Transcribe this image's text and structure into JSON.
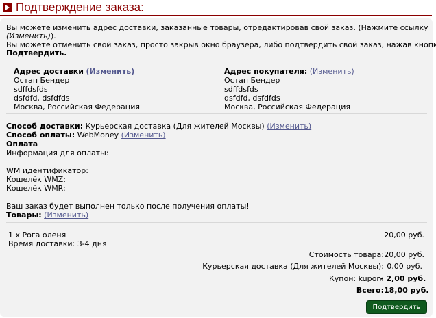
{
  "header": {
    "title": "Подтверждение заказа:"
  },
  "intro": {
    "line1": "Вы можете изменить адрес доставки, заказанные товары, отредактировав свой заказ. (Нажмите ссылку",
    "line2": "(Изменить)",
    "line2_suffix": ").",
    "line3": "Вы можете отменить свой заказ, просто закрыв окно браузера, либо подтвердить свой заказ, нажав кнопку",
    "line4": "Подтвердить."
  },
  "shipping_address": {
    "heading": "Адрес доставки",
    "edit": "(Изменить)",
    "lines": [
      "Остап Бендер",
      "sdffdsfds",
      "dsfdfd, dsfdfds",
      "Москва, Российская Федерация"
    ]
  },
  "billing_address": {
    "heading": "Адрес покупателя:",
    "edit": "(Изменить)",
    "lines": [
      "Остап Бендер",
      "sdffdsfds",
      "dsfdfd, dsfdfds",
      "Москва, Российская Федерация"
    ]
  },
  "delivery": {
    "label": "Способ доставки:",
    "value": "Курьерская доставка (Для жителей Москвы)",
    "edit": "(Изменить)"
  },
  "payment": {
    "label": "Способ оплаты:",
    "value": "WebMoney",
    "edit": "(Изменить)",
    "section_title": "Оплата",
    "info_label": "Информация для оплаты:",
    "wm_id": "WM идентификатор:",
    "wmz": "Кошелёк WMZ:",
    "wmr": "Кошелёк WMR:",
    "notice": "Ваш заказ будет выполнен только после получения оплаты!"
  },
  "goods": {
    "label": "Товары:",
    "edit": "(Изменить)",
    "items": [
      {
        "name": "1 x Рога оленя",
        "price": "20,00 руб.",
        "delivery_time": "Время доставки: 3-4 дня"
      }
    ]
  },
  "totals": [
    {
      "label": "Стоимость товара:",
      "value": "20,00 руб."
    },
    {
      "label": "Курьерская доставка (Для жителей Москвы):",
      "value": "0,00 руб."
    },
    {
      "label": "Купон: kupon:",
      "value": "- 2,00 руб."
    },
    {
      "label": "Всего:",
      "value": "18,00 руб."
    }
  ],
  "confirm_button": "Подтвердить"
}
